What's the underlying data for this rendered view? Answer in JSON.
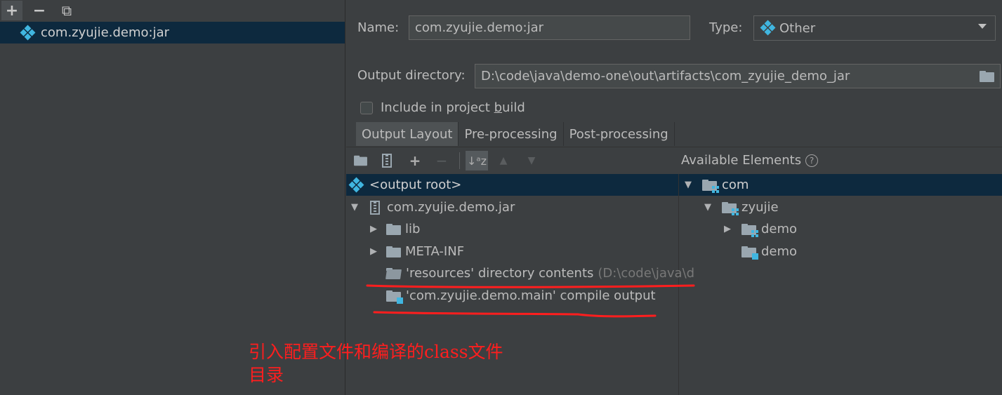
{
  "left_panel": {
    "toolbar": {
      "add": "+",
      "remove": "−",
      "copy": "⧉"
    },
    "items": [
      {
        "label": "com.zyujie.demo:jar",
        "icon": "artifact-diamond-icon"
      }
    ]
  },
  "form": {
    "name_label": "Name:",
    "name_value": "com.zyujie.demo:jar",
    "type_label": "Type:",
    "type_value": "Other",
    "output_dir_label": "Output directory:",
    "output_dir_value": "D:\\code\\java\\demo-one\\out\\artifacts\\com_zyujie_demo_jar",
    "include_label_pre": "Include in project ",
    "include_label_mnemonic": "b",
    "include_label_post": "uild",
    "include_checked": false
  },
  "tabs": [
    {
      "label": "Output Layout",
      "active": true
    },
    {
      "label": "Pre-processing",
      "active": false
    },
    {
      "label": "Post-processing",
      "active": false
    }
  ],
  "available_elements_label": "Available Elements",
  "layout_tree": {
    "root": "<output root>",
    "jar": "com.zyujie.demo.jar",
    "lib": "lib",
    "meta_inf": "META-INF",
    "resources": "'resources' directory contents",
    "resources_path": "(D:\\code\\java\\d",
    "compile_output": "'com.zyujie.demo.main' compile output"
  },
  "available_tree": {
    "com": "com",
    "zyujie": "zyujie",
    "demo_pkg": "demo",
    "demo_module": "demo"
  },
  "annotation": {
    "line1": "引入配置文件和编译的class文件",
    "line2": "目录",
    "color": "#ff1e1e"
  },
  "colors": {
    "selection": "#0d293e",
    "accent": "#40b6e0",
    "background": "#3c3f41"
  }
}
